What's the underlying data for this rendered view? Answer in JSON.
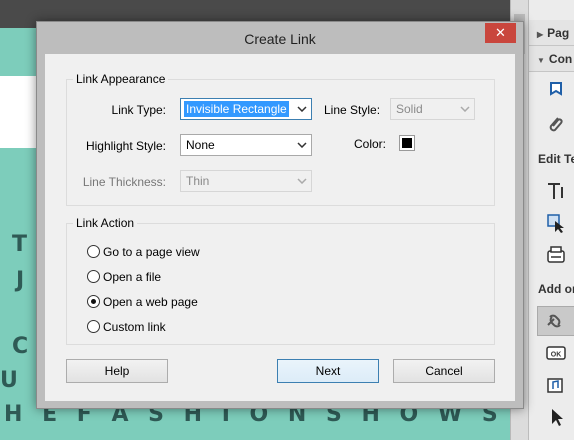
{
  "document": {
    "lines": [
      "T",
      "J",
      "C A",
      "U T",
      "H E   F A S H I O N   S H O W S"
    ]
  },
  "right_panel": {
    "section_1": "Pag",
    "section_2": "Con",
    "label_edit": "Edit Te",
    "label_add": "Add or"
  },
  "dialog": {
    "title": "Create Link",
    "close_label": "✕",
    "link_appearance": {
      "group_title": "Link Appearance",
      "link_type_label": "Link Type:",
      "link_type_value": "Invisible Rectangle",
      "line_style_label": "Line Style:",
      "line_style_value": "Solid",
      "highlight_style_label": "Highlight Style:",
      "highlight_style_value": "None",
      "color_label": "Color:",
      "color_value": "#000000",
      "line_thickness_label": "Line Thickness:",
      "line_thickness_value": "Thin"
    },
    "link_action": {
      "group_title": "Link Action",
      "options": [
        {
          "label": "Go to a page view",
          "selected": false
        },
        {
          "label": "Open a file",
          "selected": false
        },
        {
          "label": "Open a web page",
          "selected": true
        },
        {
          "label": "Custom link",
          "selected": false
        }
      ]
    },
    "buttons": {
      "help": "Help",
      "next": "Next",
      "cancel": "Cancel"
    }
  }
}
